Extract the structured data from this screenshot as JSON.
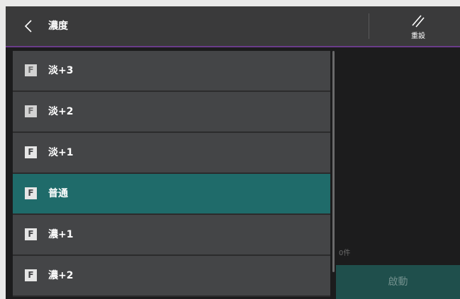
{
  "header": {
    "title": "濃度",
    "reset_label": "重設",
    "accent_color": "#6a3c8a"
  },
  "list": {
    "items": [
      {
        "label": "淡+3",
        "icon": "F",
        "selected": false
      },
      {
        "label": "淡+2",
        "icon": "F",
        "selected": false
      },
      {
        "label": "淡+1",
        "icon": "F",
        "selected": false
      },
      {
        "label": "普通",
        "icon": "F",
        "selected": true
      },
      {
        "label": "濃+1",
        "icon": "F",
        "selected": false
      },
      {
        "label": "濃+2",
        "icon": "F",
        "selected": false
      }
    ],
    "selected_color": "#1f6b6a"
  },
  "side": {
    "count": "0件",
    "start_label": "啟動"
  }
}
